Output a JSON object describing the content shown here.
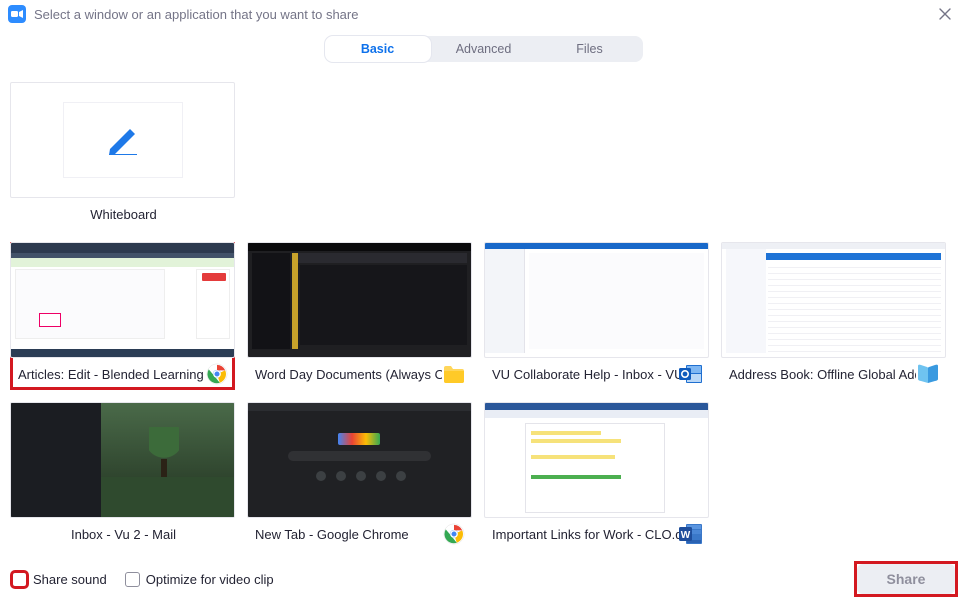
{
  "titlebar": {
    "text": "Select a window or an application that you want to share"
  },
  "tabs": {
    "basic": "Basic",
    "advanced": "Advanced",
    "files": "Files",
    "active": "basic"
  },
  "whiteboard": {
    "label": "Whiteboard"
  },
  "windows": [
    {
      "label": "Articles: Edit - Blended Learning ...",
      "app": "chrome",
      "selected": true
    },
    {
      "label": "Word Day Documents (Always O...",
      "app": "folder"
    },
    {
      "label": "VU Collaborate Help - Inbox - VU...",
      "app": "outlook"
    },
    {
      "label": "Address Book: Offline Global Add...",
      "app": "addressbook"
    },
    {
      "label": "Inbox - Vu 2 - Mail",
      "app": "mail"
    },
    {
      "label": "New Tab - Google Chrome",
      "app": "chrome"
    },
    {
      "label": "Important Links for Work - CLO.d...",
      "app": "word"
    }
  ],
  "bottom": {
    "share_sound": "Share sound",
    "optimize": "Optimize for video clip",
    "share_btn": "Share"
  },
  "colors": {
    "accent": "#0e71eb",
    "annotation": "#d31820"
  }
}
